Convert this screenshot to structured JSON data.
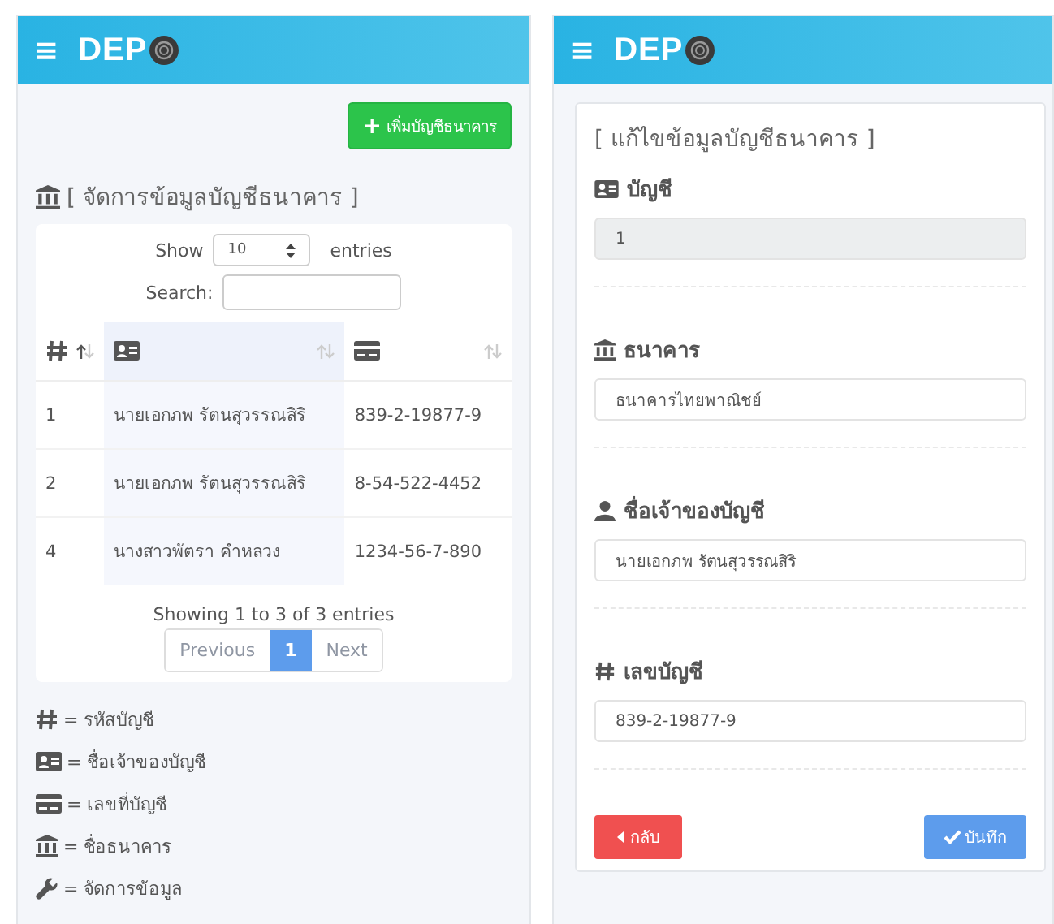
{
  "left_screen": {
    "header": {
      "menu_glyph": "≡",
      "logo_text": "DEP"
    },
    "add_button": {
      "icon_glyph": "+",
      "label": "เพิ่มบัญชีธนาคาร"
    },
    "title": "[ จัดการข้อมูลบัญชีธนาคาร ]",
    "table": {
      "show_label": "Show",
      "page_size": "10",
      "entries_label": "entries",
      "search_label": "Search:",
      "columns": [
        {
          "kind": "hash",
          "sorted": true,
          "highlighted": false
        },
        {
          "kind": "id-card",
          "sorted": false,
          "highlighted": true
        },
        {
          "kind": "credit-card",
          "sorted": false,
          "highlighted": false
        }
      ],
      "rows": [
        [
          "1",
          "นายเอกภพ รัตนสุวรรณสิริ",
          "839-2-19877-9"
        ],
        [
          "2",
          "นายเอกภพ รัตนสุวรรณสิริ",
          "8-54-522-4452"
        ],
        [
          "4",
          "นางสาวพัตรา คำหลวง",
          "1234-56-7-890"
        ]
      ],
      "info": "Showing 1 to 3 of 3 entries",
      "pagination": [
        {
          "label": "Previous",
          "selected": false,
          "disabled": true
        },
        {
          "label": "1",
          "selected": true,
          "disabled": false
        },
        {
          "label": "Next",
          "selected": false,
          "disabled": true
        }
      ]
    },
    "legend": [
      {
        "kind": "hash",
        "text": "= รหัสบัญชี"
      },
      {
        "kind": "id-card",
        "text": "= ชื่อเจ้าของบัญชี"
      },
      {
        "kind": "credit-card",
        "text": "= เลขที่บัญชี"
      },
      {
        "kind": "bank",
        "text": "= ชื่อธนาคาร"
      },
      {
        "kind": "wrench",
        "text": "= จัดการข้อมูล"
      }
    ]
  },
  "right_screen": {
    "header": {
      "menu_glyph": "≡",
      "logo_text": "DEP"
    },
    "title": "[ แก้ไขข้อมูลบัญชีธนาคาร ]",
    "fields": [
      {
        "kind": "id-card",
        "label": "บัญชี",
        "value": "1",
        "disabled": true
      },
      {
        "kind": "bank",
        "label": "ธนาคาร",
        "value": "ธนาคารไทยพาณิชย์",
        "disabled": false
      },
      {
        "kind": "user",
        "label": "ชื่อเจ้าของบัญชี",
        "value": "นายเอกภพ รัตนสุวรรณสิริ",
        "disabled": false
      },
      {
        "kind": "hash",
        "label": "เลขบัญชี",
        "value": "839-2-19877-9",
        "disabled": false
      }
    ],
    "back_button": {
      "label": "กลับ"
    },
    "save_button": {
      "label": "บันทึก"
    }
  }
}
